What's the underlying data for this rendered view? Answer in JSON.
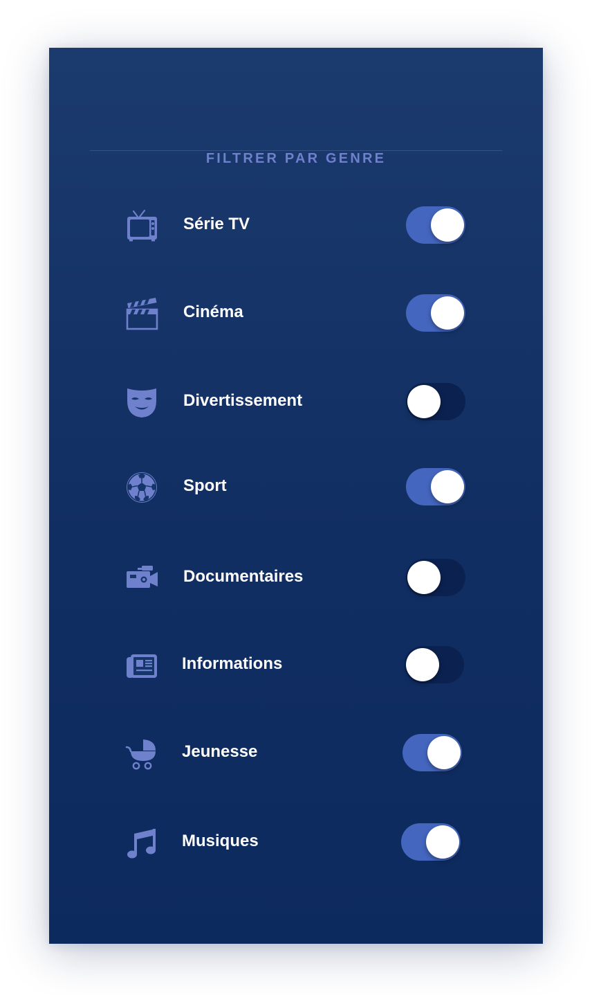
{
  "colors": {
    "panel_top": "#1b3a6e",
    "panel_bottom": "#0d2a5e",
    "accent": "#6f80cc",
    "toggle_on": "#4466bf",
    "toggle_off": "#0b2150",
    "label": "#ffffff"
  },
  "header": {
    "title": "FILTRER PAR GENRE"
  },
  "genres": [
    {
      "label": "Série TV",
      "icon": "tv-icon",
      "enabled": true
    },
    {
      "label": "Cinéma",
      "icon": "clapperboard-icon",
      "enabled": true
    },
    {
      "label": "Divertissement",
      "icon": "theater-mask-icon",
      "enabled": false
    },
    {
      "label": "Sport",
      "icon": "soccer-ball-icon",
      "enabled": true
    },
    {
      "label": "Documentaires",
      "icon": "video-camera-icon",
      "enabled": false
    },
    {
      "label": "Informations",
      "icon": "newspaper-icon",
      "enabled": false
    },
    {
      "label": "Jeunesse",
      "icon": "baby-stroller-icon",
      "enabled": true
    },
    {
      "label": "Musiques",
      "icon": "music-note-icon",
      "enabled": true
    }
  ]
}
